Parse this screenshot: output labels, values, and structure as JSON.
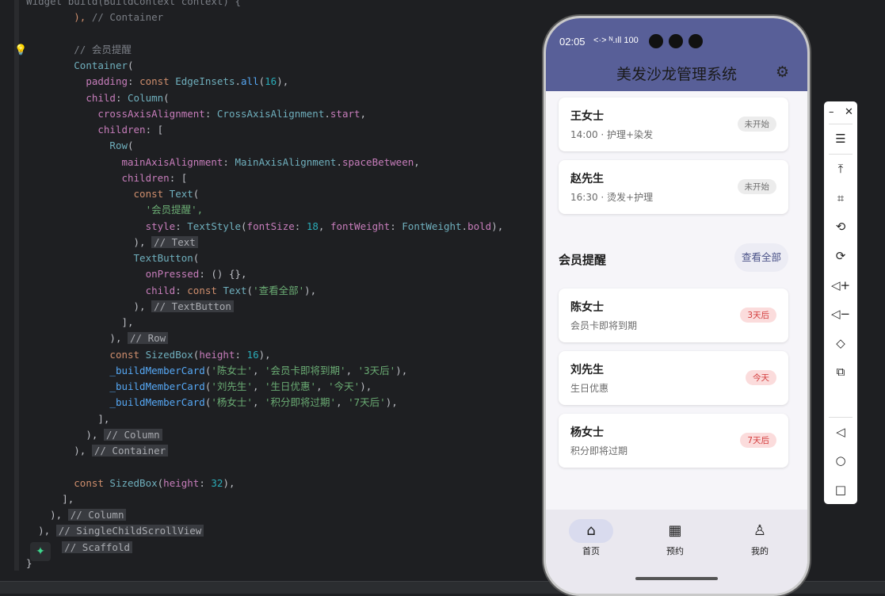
{
  "editor": {
    "lines": [
      [
        {
          "t": "  Widget build(BuildContext context) {",
          "c": "cmt"
        }
      ],
      [
        {
          "t": "          "
        },
        {
          "t": "), ",
          "c": "kw"
        },
        {
          "t": "// Container",
          "c": "cmt"
        }
      ],
      [
        {
          "t": ""
        }
      ],
      [
        {
          "t": "          "
        },
        {
          "t": "// 会员提醒",
          "c": "cmt"
        }
      ],
      [
        {
          "t": "          "
        },
        {
          "t": "Container",
          "c": "cls"
        },
        {
          "t": "("
        }
      ],
      [
        {
          "t": "            "
        },
        {
          "t": "padding",
          "c": "fld"
        },
        {
          "t": ": "
        },
        {
          "t": "const ",
          "c": "kw"
        },
        {
          "t": "EdgeInsets",
          "c": "cls"
        },
        {
          "t": "."
        },
        {
          "t": "all",
          "c": "fn"
        },
        {
          "t": "("
        },
        {
          "t": "16",
          "c": "num"
        },
        {
          "t": "),"
        }
      ],
      [
        {
          "t": "            "
        },
        {
          "t": "child",
          "c": "fld"
        },
        {
          "t": ": "
        },
        {
          "t": "Column",
          "c": "cls"
        },
        {
          "t": "("
        }
      ],
      [
        {
          "t": "              "
        },
        {
          "t": "crossAxisAlignment",
          "c": "fld"
        },
        {
          "t": ": "
        },
        {
          "t": "CrossAxisAlignment",
          "c": "cls"
        },
        {
          "t": "."
        },
        {
          "t": "start",
          "c": "fld"
        },
        {
          "t": ","
        }
      ],
      [
        {
          "t": "              "
        },
        {
          "t": "children",
          "c": "fld"
        },
        {
          "t": ": ["
        }
      ],
      [
        {
          "t": "                "
        },
        {
          "t": "Row",
          "c": "cls"
        },
        {
          "t": "("
        }
      ],
      [
        {
          "t": "                  "
        },
        {
          "t": "mainAxisAlignment",
          "c": "fld"
        },
        {
          "t": ": "
        },
        {
          "t": "MainAxisAlignment",
          "c": "cls"
        },
        {
          "t": "."
        },
        {
          "t": "spaceBetween",
          "c": "fld"
        },
        {
          "t": ","
        }
      ],
      [
        {
          "t": "                  "
        },
        {
          "t": "children",
          "c": "fld"
        },
        {
          "t": ": ["
        }
      ],
      [
        {
          "t": "                    "
        },
        {
          "t": "const ",
          "c": "kw"
        },
        {
          "t": "Text",
          "c": "cls"
        },
        {
          "t": "("
        }
      ],
      [
        {
          "t": "                      "
        },
        {
          "t": "'会员提醒',",
          "c": "str"
        }
      ],
      [
        {
          "t": "                      "
        },
        {
          "t": "style",
          "c": "fld"
        },
        {
          "t": ": "
        },
        {
          "t": "TextStyle",
          "c": "cls"
        },
        {
          "t": "("
        },
        {
          "t": "fontSize",
          "c": "fld"
        },
        {
          "t": ": "
        },
        {
          "t": "18",
          "c": "num"
        },
        {
          "t": ", "
        },
        {
          "t": "fontWeight",
          "c": "fld"
        },
        {
          "t": ": "
        },
        {
          "t": "FontWeight",
          "c": "cls"
        },
        {
          "t": "."
        },
        {
          "t": "bold",
          "c": "fld"
        },
        {
          "t": "),"
        }
      ],
      [
        {
          "t": "                    "
        },
        {
          "t": "), "
        },
        {
          "t": "// Text",
          "c": "cmtbox"
        }
      ],
      [
        {
          "t": "                    "
        },
        {
          "t": "TextButton",
          "c": "cls"
        },
        {
          "t": "("
        }
      ],
      [
        {
          "t": "                      "
        },
        {
          "t": "onPressed",
          "c": "fld"
        },
        {
          "t": ": () {},"
        }
      ],
      [
        {
          "t": "                      "
        },
        {
          "t": "child",
          "c": "fld"
        },
        {
          "t": ": "
        },
        {
          "t": "const ",
          "c": "kw"
        },
        {
          "t": "Text",
          "c": "cls"
        },
        {
          "t": "("
        },
        {
          "t": "'查看全部'",
          "c": "str"
        },
        {
          "t": "),"
        }
      ],
      [
        {
          "t": "                    "
        },
        {
          "t": "), "
        },
        {
          "t": "// TextButton",
          "c": "cmtbox"
        }
      ],
      [
        {
          "t": "                  "
        },
        {
          "t": "],"
        }
      ],
      [
        {
          "t": "                "
        },
        {
          "t": "), "
        },
        {
          "t": "// Row",
          "c": "cmtbox"
        }
      ],
      [
        {
          "t": "                "
        },
        {
          "t": "const ",
          "c": "kw"
        },
        {
          "t": "SizedBox",
          "c": "cls"
        },
        {
          "t": "("
        },
        {
          "t": "height",
          "c": "fld"
        },
        {
          "t": ": "
        },
        {
          "t": "16",
          "c": "num"
        },
        {
          "t": "),"
        }
      ],
      [
        {
          "t": "                "
        },
        {
          "t": "_buildMemberCard",
          "c": "fn"
        },
        {
          "t": "("
        },
        {
          "t": "'陈女士'",
          "c": "str"
        },
        {
          "t": ", "
        },
        {
          "t": "'会员卡即将到期'",
          "c": "str"
        },
        {
          "t": ", "
        },
        {
          "t": "'3天后'",
          "c": "str"
        },
        {
          "t": "),"
        }
      ],
      [
        {
          "t": "                "
        },
        {
          "t": "_buildMemberCard",
          "c": "fn"
        },
        {
          "t": "("
        },
        {
          "t": "'刘先生'",
          "c": "str"
        },
        {
          "t": ", "
        },
        {
          "t": "'生日优惠'",
          "c": "str"
        },
        {
          "t": ", "
        },
        {
          "t": "'今天'",
          "c": "str"
        },
        {
          "t": "),"
        }
      ],
      [
        {
          "t": "                "
        },
        {
          "t": "_buildMemberCard",
          "c": "fn"
        },
        {
          "t": "("
        },
        {
          "t": "'杨女士'",
          "c": "str"
        },
        {
          "t": ", "
        },
        {
          "t": "'积分即将过期'",
          "c": "str"
        },
        {
          "t": ", "
        },
        {
          "t": "'7天后'",
          "c": "str"
        },
        {
          "t": "),"
        }
      ],
      [
        {
          "t": "              "
        },
        {
          "t": "],"
        }
      ],
      [
        {
          "t": "            "
        },
        {
          "t": "), "
        },
        {
          "t": "// Column",
          "c": "cmtbox"
        }
      ],
      [
        {
          "t": "          "
        },
        {
          "t": "), "
        },
        {
          "t": "// Container",
          "c": "cmtbox"
        }
      ],
      [
        {
          "t": ""
        }
      ],
      [
        {
          "t": "          "
        },
        {
          "t": "const ",
          "c": "kw"
        },
        {
          "t": "SizedBox",
          "c": "cls"
        },
        {
          "t": "("
        },
        {
          "t": "height",
          "c": "fld"
        },
        {
          "t": ": "
        },
        {
          "t": "32",
          "c": "num"
        },
        {
          "t": "),"
        }
      ],
      [
        {
          "t": "        "
        },
        {
          "t": "],"
        }
      ],
      [
        {
          "t": "      "
        },
        {
          "t": "), "
        },
        {
          "t": "// Column",
          "c": "cmtbox"
        }
      ],
      [
        {
          "t": "    "
        },
        {
          "t": "), "
        },
        {
          "t": "// SingleChildScrollView",
          "c": "cmtbox"
        }
      ],
      [
        {
          "t": "    "
        },
        {
          "t": "    "
        },
        {
          "t": "// Scaffold",
          "c": "cmtbox"
        }
      ],
      [
        {
          "t": "  }"
        }
      ]
    ]
  },
  "phone": {
    "status": {
      "time": "02:05",
      "icons": "<·> ᴺ.ıll 100"
    },
    "app_title": "美发沙龙管理系统",
    "appointments": [
      {
        "name": "王女士",
        "detail": "14:00 · 护理+染发",
        "status": "未开始"
      },
      {
        "name": "赵先生",
        "detail": "16:30 · 烫发+护理",
        "status": "未开始"
      }
    ],
    "member_section": {
      "title": "会员提醒",
      "view_all": "查看全部"
    },
    "members": [
      {
        "name": "陈女士",
        "detail": "会员卡即将到期",
        "badge": "3天后"
      },
      {
        "name": "刘先生",
        "detail": "生日优惠",
        "badge": "今天"
      },
      {
        "name": "杨女士",
        "detail": "积分即将过期",
        "badge": "7天后"
      }
    ],
    "nav": [
      {
        "label": "首页",
        "icon": "home-icon"
      },
      {
        "label": "预约",
        "icon": "calendar-icon"
      },
      {
        "label": "我的",
        "icon": "person-icon"
      }
    ]
  },
  "colors": {
    "appbar": "#585f98",
    "accent": "#4a5288",
    "badge_red": "#d33b3b"
  },
  "emulator_toolbar": {
    "buttons": [
      "minimize-icon",
      "close-icon",
      "menu-icon",
      "pin-top-icon",
      "crop-icon",
      "rotate-left-icon",
      "rotate-right-icon",
      "volume-up-icon",
      "volume-down-icon",
      "shake-icon",
      "screenshot-icon",
      "back-icon",
      "home-icon",
      "overview-icon"
    ]
  }
}
